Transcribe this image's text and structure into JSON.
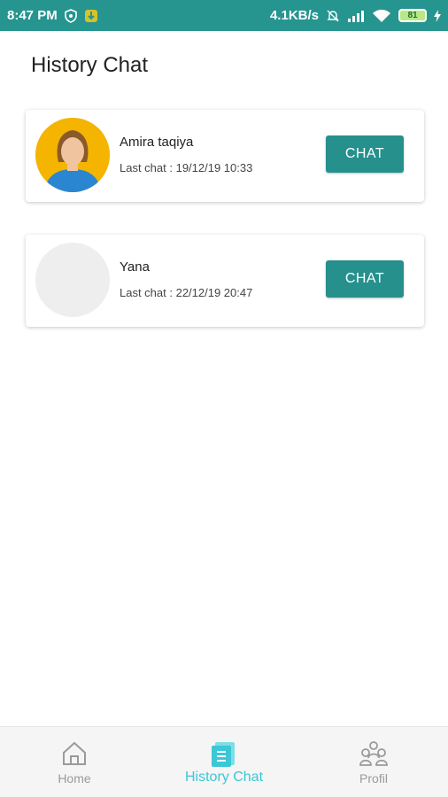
{
  "status_bar": {
    "time": "8:47 PM",
    "speed": "4.1KB/s",
    "battery": "81",
    "colors": {
      "background": "#26948f"
    },
    "icons": [
      "shield-icon",
      "app-notification-icon",
      "mute-bell-icon",
      "signal-icon",
      "wifi-icon",
      "battery-icon",
      "charging-icon"
    ]
  },
  "page": {
    "title": "History Chat"
  },
  "chats": [
    {
      "name": "Amira taqiya",
      "last_chat": "Last chat : 19/12/19 10:33",
      "button": "CHAT",
      "avatar": "photo"
    },
    {
      "name": "Yana",
      "last_chat": "Last chat : 22/12/19 20:47",
      "button": "CHAT",
      "avatar": "placeholder"
    }
  ],
  "bottom_nav": {
    "items": [
      {
        "label": "Home",
        "icon": "home-icon",
        "active": false
      },
      {
        "label": "History Chat",
        "icon": "history-chat-icon",
        "active": true
      },
      {
        "label": "Profil",
        "icon": "profile-group-icon",
        "active": false
      }
    ],
    "colors": {
      "active": "#3bc7d6",
      "inactive": "#9a9a9a"
    }
  },
  "colors": {
    "accent": "#26908c"
  }
}
